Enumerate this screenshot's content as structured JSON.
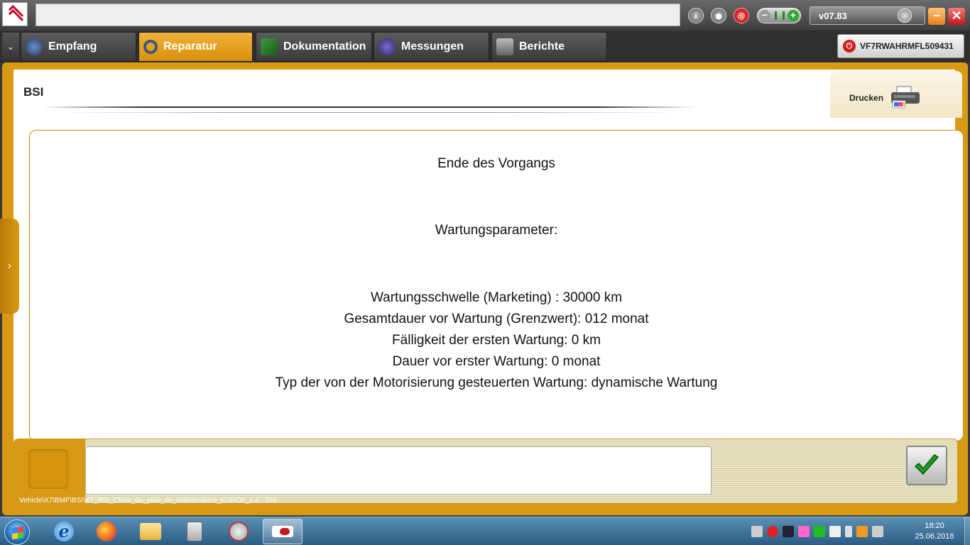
{
  "topbar": {
    "address_value": "",
    "version": "v07.83"
  },
  "tabs": [
    {
      "label": "Empfang",
      "icon": "home-icon"
    },
    {
      "label": "Reparatur",
      "icon": "search-icon"
    },
    {
      "label": "Dokumentation",
      "icon": "book-icon"
    },
    {
      "label": "Messungen",
      "icon": "waveform-icon"
    },
    {
      "label": "Berichte",
      "icon": "report-icon"
    }
  ],
  "vin": "VF7RWAHRMFL509431",
  "panel": {
    "title": "BSI",
    "print_label": "Drucken"
  },
  "content": {
    "heading": "Ende des Vorgangs",
    "subheading": "Wartungsparameter:",
    "lines": [
      "Wartungsschwelle (Marketing) : 30000 km",
      "Gesamtdauer vor Wartung (Grenzwert): 012 monat",
      "Fälligkeit der ersten Wartung: 0 km",
      "Dauer vor erster Wartung: 0 monat",
      "Typ der von der Motorisierung gesteuerten Wartung: dynamische Wartung"
    ]
  },
  "footer": {
    "message_value": "",
    "path": "Vehicle\\X7\\BMF\\BSI\\X7_BSI_Choix_du_plan_de_maintenance_EURO6_1.s : 336"
  },
  "taskbar": {
    "time": "18:20",
    "date": "25.06.2018"
  },
  "colors": {
    "accent": "#d89a14",
    "active_tab": "#f0b23a",
    "taskbar": "#2b5d84"
  }
}
